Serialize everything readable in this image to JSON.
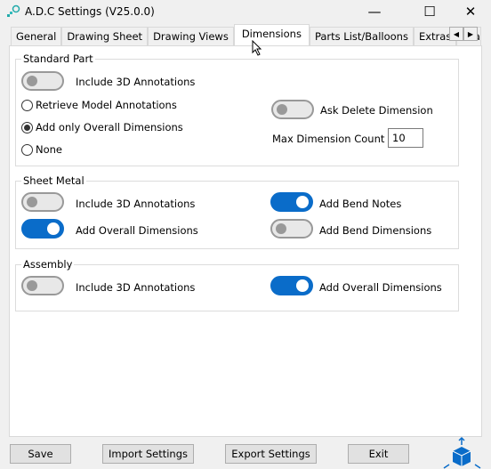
{
  "window": {
    "title": "A.D.C Settings (V25.0.0)",
    "minimize": "—",
    "maximize": "☐",
    "close": "✕"
  },
  "tabs": [
    "General",
    "Drawing Sheet",
    "Drawing Views",
    "Dimensions",
    "Parts List/Balloons",
    "Extras",
    "Draw"
  ],
  "active_tab": "Dimensions",
  "standard_part": {
    "legend": "Standard Part",
    "include_3d": {
      "label": "Include 3D Annotations",
      "on": false
    },
    "radios": [
      {
        "label": "Retrieve Model Annotations",
        "selected": false
      },
      {
        "label": "Add only Overall Dimensions",
        "selected": true
      },
      {
        "label": "None",
        "selected": false
      }
    ],
    "ask_delete": {
      "label": "Ask Delete Dimension",
      "on": false
    },
    "max_count": {
      "label": "Max Dimension Count",
      "value": "10"
    }
  },
  "sheet_metal": {
    "legend": "Sheet Metal",
    "include_3d": {
      "label": "Include 3D Annotations",
      "on": false
    },
    "overall": {
      "label": "Add Overall Dimensions",
      "on": true
    },
    "bend_notes": {
      "label": "Add Bend Notes",
      "on": true
    },
    "bend_dims": {
      "label": "Add Bend Dimensions",
      "on": false
    }
  },
  "assembly": {
    "legend": "Assembly",
    "include_3d": {
      "label": "Include 3D Annotations",
      "on": false
    },
    "overall": {
      "label": "Add Overall Dimensions",
      "on": true
    }
  },
  "buttons": {
    "save": "Save",
    "import": "Import Settings",
    "export": "Export Settings",
    "exit": "Exit"
  },
  "colors": {
    "accent": "#0a6cc9"
  }
}
